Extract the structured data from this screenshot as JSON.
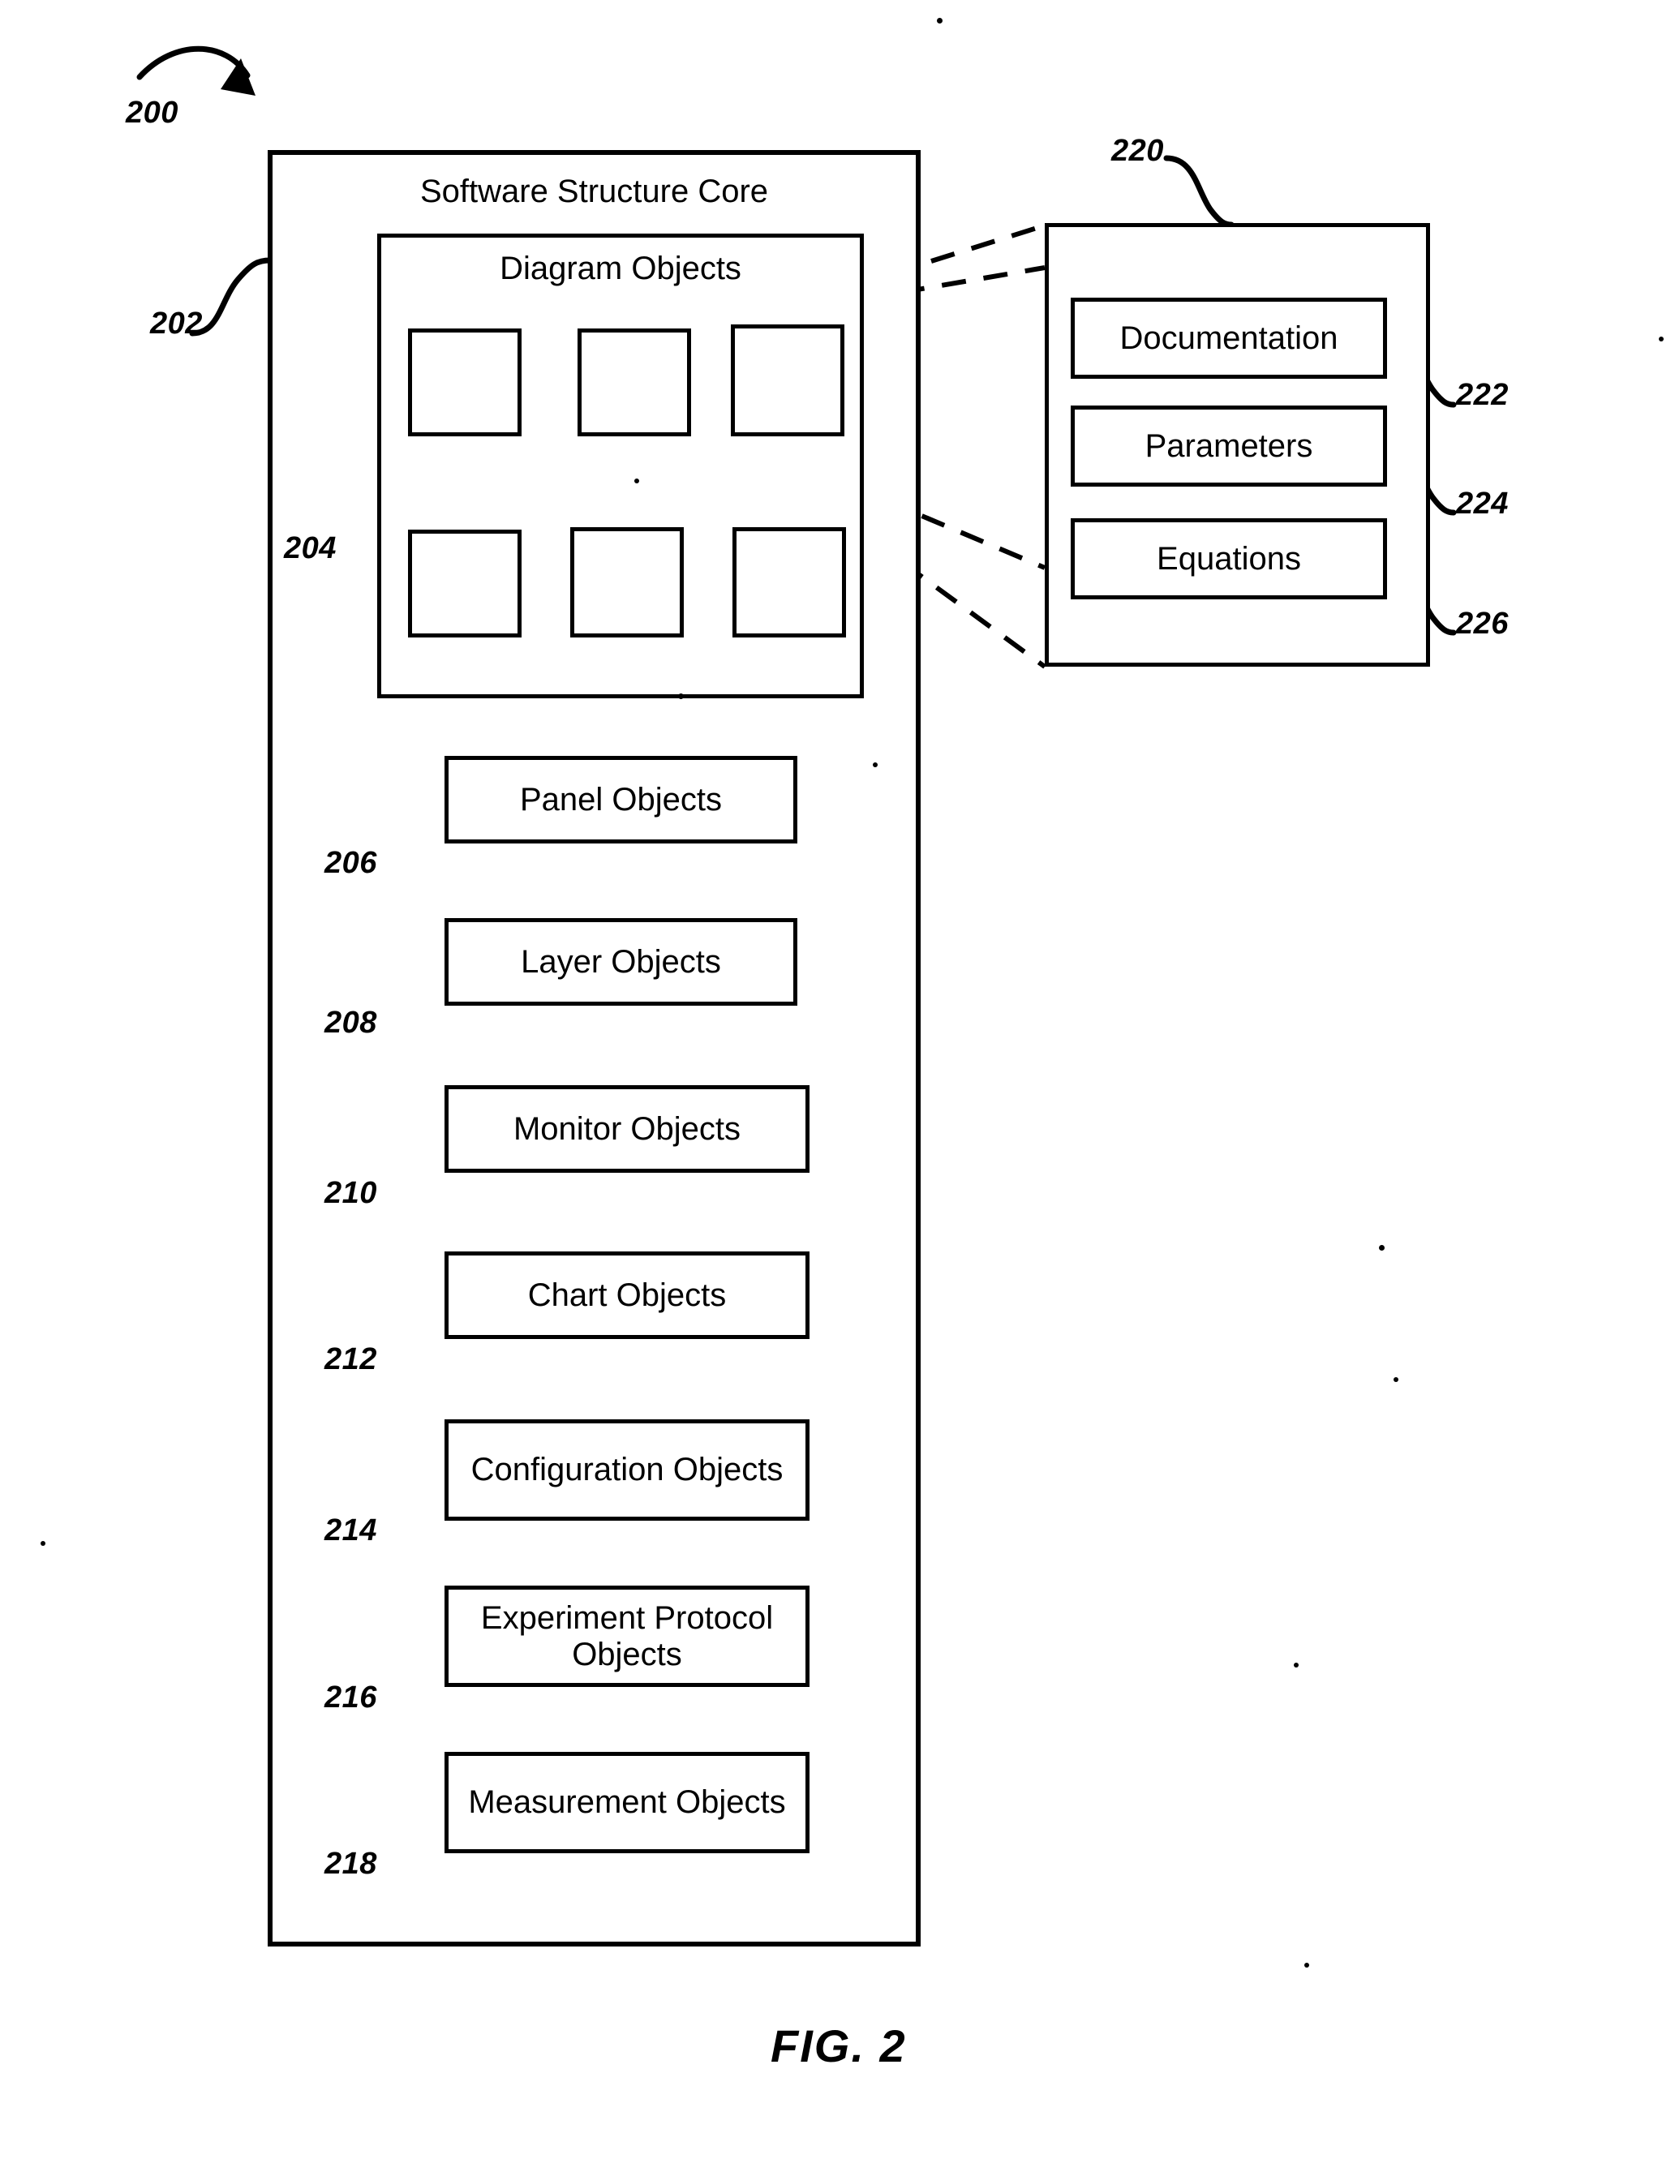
{
  "figure": {
    "caption": "FIG. 2",
    "top_ref": "200"
  },
  "core": {
    "title": "Software Structure Core",
    "ref": "202"
  },
  "diagram_objects": {
    "title": "Diagram Objects",
    "ref": "204",
    "squares": [
      {
        "name": "diagram-object-1"
      },
      {
        "name": "diagram-object-2"
      },
      {
        "name": "diagram-object-3"
      },
      {
        "name": "diagram-object-4"
      },
      {
        "name": "diagram-object-5"
      },
      {
        "name": "diagram-object-6"
      }
    ]
  },
  "object_list": [
    {
      "label": "Panel Objects",
      "ref": "206"
    },
    {
      "label": "Layer Objects",
      "ref": "208"
    },
    {
      "label": "Monitor Objects",
      "ref": "210"
    },
    {
      "label": "Chart Objects",
      "ref": "212"
    },
    {
      "label": "Configuration Objects",
      "ref": "214"
    },
    {
      "label": "Experiment Protocol Objects",
      "ref": "216"
    },
    {
      "label": "Measurement Objects",
      "ref": "218"
    }
  ],
  "detail_panel": {
    "ref": "220",
    "items": [
      {
        "label": "Documentation",
        "ref": "222"
      },
      {
        "label": "Parameters",
        "ref": "224"
      },
      {
        "label": "Equations",
        "ref": "226"
      }
    ]
  },
  "colors": {
    "ink": "#000000",
    "paper": "#ffffff"
  }
}
